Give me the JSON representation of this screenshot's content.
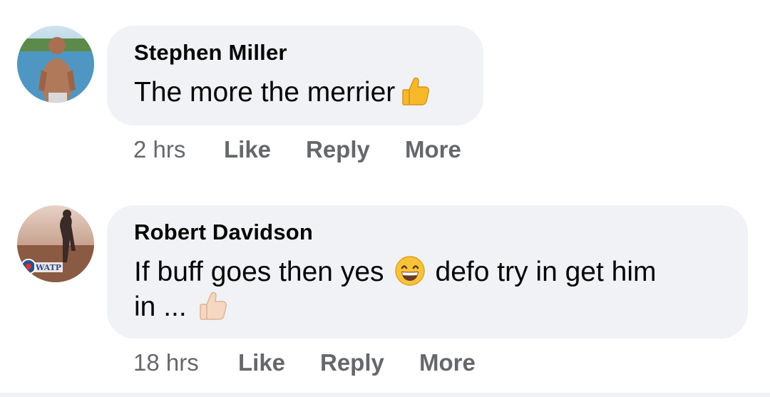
{
  "comments": [
    {
      "author": "Stephen Miller",
      "text": "The more the merrier",
      "emoji": "thumbs-up-icon",
      "time": "2 hrs",
      "like_label": "Like",
      "reply_label": "Reply",
      "more_label": "More"
    },
    {
      "author": "Robert Davidson",
      "text_line1": "If buff goes then yes",
      "emoji_inline": "grinning-face-icon",
      "text_line1_rest": "defo try in get him",
      "text_line2": "in ...",
      "emoji": "thumbs-up-light-skin-icon",
      "avatar_badge_text": "WATP",
      "time": "18 hrs",
      "like_label": "Like",
      "reply_label": "Reply",
      "more_label": "More"
    }
  ],
  "colors": {
    "bubble": "#f0f2f5",
    "author_text": "#050505",
    "meta_text": "#65676b"
  }
}
